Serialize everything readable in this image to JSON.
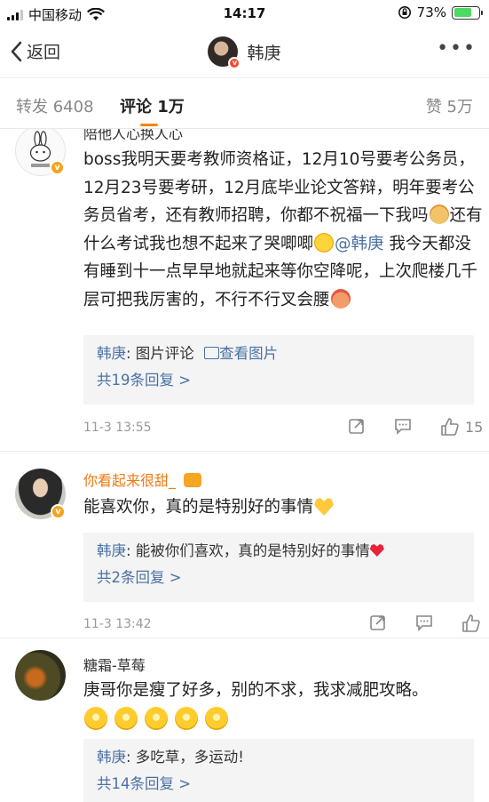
{
  "status_bar": {
    "carrier": "中国移动",
    "time": "14:17",
    "battery_pct": "73%",
    "battery_level": 0.73
  },
  "nav": {
    "back_label": "返回",
    "title": "韩庚"
  },
  "tabs": {
    "repost": "转发 6408",
    "comment": "评论 1万",
    "like": "赞 5万"
  },
  "comments": [
    {
      "name": "陪他人心换人心",
      "text_a": "boss我明天要考教师资格证，12月10号要考公务员，12月23号要考研，12月底毕业论文答辩，明年要考公务员省考，还有教师招聘，你都不祝福一下我吗",
      "text_b": "还有什么考试我也想不起来了哭唧唧",
      "mention": "@韩庚",
      "text_c": " 我今天都没有睡到十一点早早地就起来等你空降呢，上次爬楼几千层可把我厉害的，不行不行叉会腰",
      "reply_author": "韩庚",
      "reply_text": ": 图片评论 ",
      "reply_link": "查看图片",
      "more_replies": "共19条回复 >",
      "time": "11-3 13:55",
      "likes": "15"
    },
    {
      "name": "你看起来很甜_",
      "text": "能喜欢你，真的是特别好的事情",
      "reply_author": "韩庚",
      "reply_text": ": 能被你们喜欢，真的是特别好的事情",
      "more_replies": "共2条回复 >",
      "time": "11-3 13:42",
      "likes": ""
    },
    {
      "name": "糖霜-草莓",
      "text": "庚哥你是瘦了好多，别的不求，我求减肥攻略。",
      "reply_author": "韩庚",
      "reply_text": ": 多吃草，多运动!",
      "more_replies": "共14条回复 >"
    }
  ],
  "colors": {
    "accent": "#ff8200",
    "link": "#4a71a6",
    "verified": "#f7a21b"
  },
  "icons": [
    "signal-icon",
    "wifi-icon",
    "lock-rotation-icon",
    "battery-icon",
    "back-chevron-icon",
    "more-icon",
    "repost-icon",
    "comment-icon",
    "like-icon"
  ]
}
